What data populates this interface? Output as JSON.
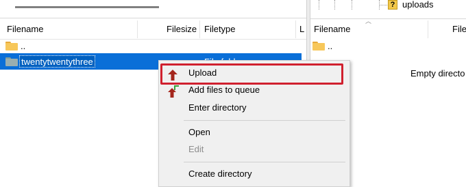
{
  "local_pane": {
    "columns": {
      "filename": "Filename",
      "filesize": "Filesize",
      "filetype": "Filetype",
      "last_modified_fragment": "L"
    },
    "rows": [
      {
        "name": "..",
        "icon": "folder-icon",
        "filetype": "",
        "selected": false
      },
      {
        "name": "twentytwentythree",
        "icon": "folder-icon",
        "filetype": "File folder",
        "selected": true
      }
    ]
  },
  "remote_pane": {
    "tree": {
      "folder": "uploads",
      "icon": "question-folder-icon"
    },
    "columns": {
      "filename": "Filename",
      "filesize_fragment": "File"
    },
    "rows": [
      {
        "name": "..",
        "icon": "folder-icon"
      }
    ],
    "empty_message": "Empty directo"
  },
  "context_menu": {
    "items": [
      {
        "label": "Upload",
        "icon": "upload-arrow-icon",
        "enabled": true,
        "highlighted": true
      },
      {
        "label": "Add files to queue",
        "icon": "add-to-queue-icon",
        "enabled": true
      },
      {
        "label": "Enter directory",
        "enabled": true
      },
      {
        "label": "Open",
        "enabled": true
      },
      {
        "label": "Edit",
        "enabled": false
      },
      {
        "label": "Create directory",
        "enabled": true
      }
    ],
    "highlight_color": "#d0202e"
  },
  "colors": {
    "selection": "#0a6fd8",
    "menu_background": "#f0f0f0",
    "folder_yellow": "#f7c75a",
    "disabled_text": "#8d8d8d"
  }
}
